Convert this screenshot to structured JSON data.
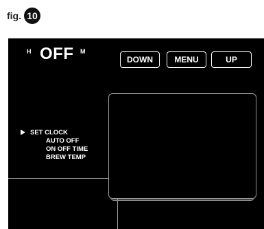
{
  "figure": {
    "prefix": "fig.",
    "number": "10"
  },
  "display": {
    "h_label": "H",
    "status": "OFF",
    "m_label": "M"
  },
  "buttons": {
    "down": "DOWN",
    "menu": "MENU",
    "up": "UP"
  },
  "menu": {
    "items": [
      {
        "label": "SET CLOCK",
        "selected": true
      },
      {
        "label": "AUTO OFF",
        "selected": false
      },
      {
        "label": "ON OFF TIME",
        "selected": false
      },
      {
        "label": "BREW TEMP",
        "selected": false
      }
    ]
  },
  "icons": {
    "selector": "triangle-right-icon"
  },
  "colors": {
    "screen_bg": "#000000",
    "text": "#ffffff",
    "border": "#9a9a9a"
  }
}
